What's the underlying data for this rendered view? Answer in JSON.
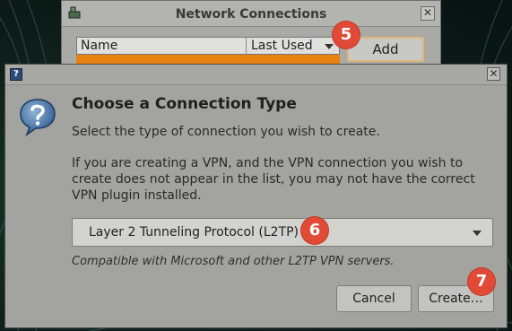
{
  "bg_window": {
    "title": "Network Connections",
    "close_glyph": "✕",
    "columns": [
      "Name",
      "Last Used"
    ],
    "add_label": "Add",
    "icon": "network-connections-icon"
  },
  "dialog": {
    "help_glyph": "?",
    "close_glyph": "✕",
    "heading": "Choose a Connection Type",
    "subtitle": "Select the type of connection you wish to create.",
    "info": "If you are creating a VPN, and the VPN connection you wish to create does not appear in the list, you may not have the correct VPN plugin installed.",
    "connection_type": {
      "selected": "Layer 2 Tunneling Protocol (L2TP)",
      "description": "Compatible with Microsoft and other L2TP VPN servers."
    },
    "cancel_label": "Cancel",
    "create_label": "Create…"
  },
  "badges": {
    "add": "5",
    "select": "6",
    "create": "7"
  },
  "colors": {
    "selected_row": "#e8820e",
    "badge": "#e04a37",
    "dialog_bg": "#a3a3a0"
  }
}
